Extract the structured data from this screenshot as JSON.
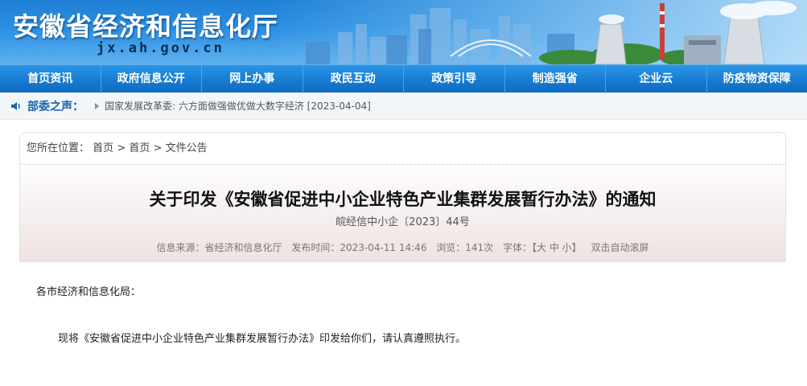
{
  "site": {
    "title": "安徽省经济和信息化厅",
    "domain": "jx.ah.gov.cn"
  },
  "nav": [
    "首页资讯",
    "政府信息公开",
    "网上办事",
    "政民互动",
    "政策引导",
    "制造强省",
    "企业云",
    "防疫物资保障"
  ],
  "ticker": {
    "label": "部委之声：",
    "text": "国家发展改革委: 六方面做强做优做大数字经济 [2023-04-04]"
  },
  "breadcrumb": {
    "prefix": "您所在位置：",
    "items": [
      "首页",
      "首页",
      "文件公告"
    ],
    "separator": ">"
  },
  "article": {
    "title": "关于印发《安徽省促进中小企业特色产业集群发展暂行办法》的通知",
    "number": "皖经信中小企〔2023〕44号",
    "meta": {
      "source": "信息来源：省经济和信息化厅",
      "published": "发布时间：2023-04-11 14:46",
      "views": "浏览：141次",
      "font_label": "字体：",
      "font_sizes": "【大 中 小】",
      "autoscroll": "双击自动滚屏"
    },
    "salutation": "各市经济和信息化局：",
    "paragraph": "现将《安徽省促进中小企业特色产业集群发展暂行办法》印发给你们，请认真遵照执行。"
  },
  "colors": {
    "nav_bg": "#167ad0",
    "banner_bg": "#2b8fe2",
    "ticker_label": "#1764b0"
  }
}
